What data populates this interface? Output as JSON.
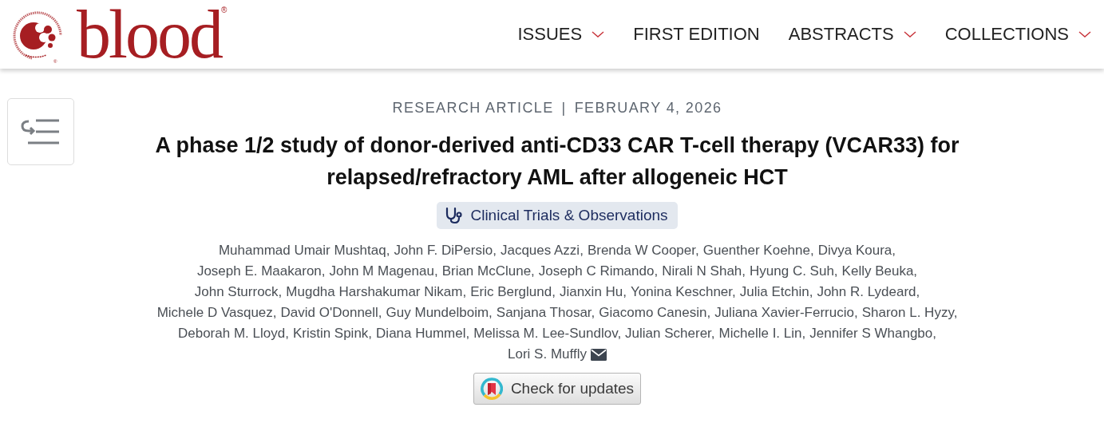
{
  "logo": {
    "registered": "®",
    "wordmark": "blood",
    "wordmark_registered": "®"
  },
  "nav": [
    {
      "label": "ISSUES",
      "dropdown": true
    },
    {
      "label": "FIRST EDITION",
      "dropdown": false
    },
    {
      "label": "ABSTRACTS",
      "dropdown": true
    },
    {
      "label": "COLLECTIONS",
      "dropdown": true
    }
  ],
  "article": {
    "type": "RESEARCH ARTICLE",
    "separator": "|",
    "date": "FEBRUARY 4, 2026",
    "title": "A phase 1/2 study of donor-derived anti-CD33 CAR T-cell therapy (VCAR33) for relapsed/refractory AML after allogeneic HCT",
    "category": "Clinical Trials & Observations",
    "author_lines": [
      [
        "Muhammad Umair Mushtaq,",
        "John F. DiPersio,",
        "Jacques Azzi,",
        "Brenda W Cooper,",
        "Guenther Koehne,",
        "Divya Koura,"
      ],
      [
        "Joseph E. Maakaron,",
        "John M Magenau,",
        "Brian McClune,",
        "Joseph C Rimando,",
        "Nirali N Shah,",
        "Hyung C. Suh,",
        "Kelly Beuka,"
      ],
      [
        "John Sturrock,",
        "Mugdha Harshakumar Nikam,",
        "Eric Berglund,",
        "Jianxin Hu,",
        "Yonina Keschner,",
        "Julia Etchin,",
        "John R. Lydeard,"
      ],
      [
        "Michele D Vasquez,",
        "David O'Donnell,",
        "Guy Mundelboim,",
        "Sanjana Thosar,",
        "Giacomo Canesin,",
        "Juliana Xavier-Ferrucio,",
        "Sharon L. Hyzy,"
      ],
      [
        "Deborah M. Lloyd,",
        "Kristin Spink,",
        "Diana Hummel,",
        "Melissa M. Lee-Sundlov,",
        "Julian Scherer,",
        "Michelle I. Lin,",
        "Jennifer S Whangbo,"
      ],
      [
        "Lori S. Muffly"
      ]
    ],
    "corresponding_author_email": true,
    "updates_button": "Check for updates"
  }
}
